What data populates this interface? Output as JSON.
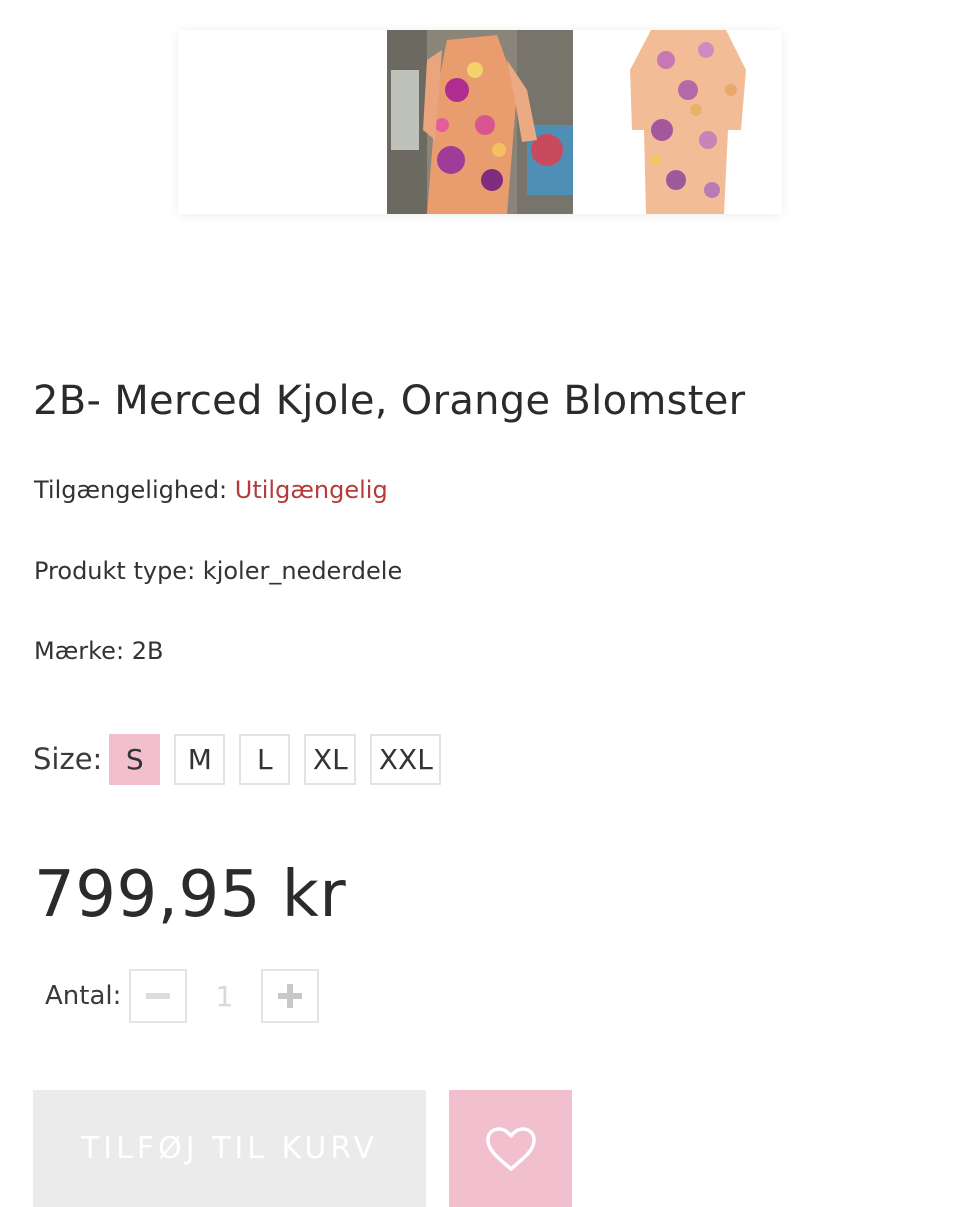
{
  "product": {
    "title": "2B- Merced Kjole, Orange Blomster",
    "availability_label": "Tilgængelighed:",
    "availability_value": "Utilgængelig",
    "type_label": "Produkt type:",
    "type_value": "kjoler_nederdele",
    "brand_label": "Mærke:",
    "brand_value": "2B"
  },
  "sizes": {
    "label": "Size:",
    "options": [
      "S",
      "M",
      "L",
      "XL",
      "XXL"
    ],
    "selected": "S"
  },
  "price": "799,95 kr",
  "quantity": {
    "label": "Antal:",
    "value": "1"
  },
  "actions": {
    "add_to_cart": "TILFØJ TIL KURV",
    "wishlist_icon": "heart-icon"
  },
  "colors": {
    "accent_pink": "#f2bfce",
    "status_unavailable": "#b53b3b",
    "disabled_button": "#ebebeb"
  }
}
